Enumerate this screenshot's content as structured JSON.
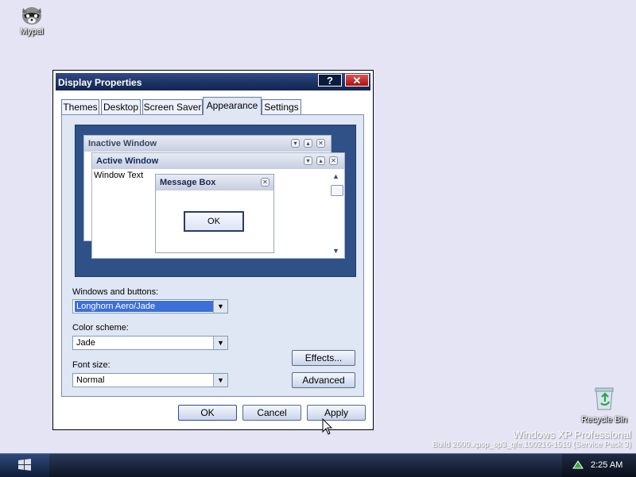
{
  "desktop": {
    "icon1_label": "Mypal",
    "recycle_label": "Recycle Bin",
    "watermark_line1": "Windows XP Professional",
    "watermark_line2": "Build 2600.xpsp_sp3_qfe.100216-1510 (Service Pack 3)"
  },
  "dialog": {
    "title": "Display Properties",
    "help_label": "?",
    "close_label": "✕",
    "tabs": [
      "Themes",
      "Desktop",
      "Screen Saver",
      "Appearance",
      "Settings"
    ],
    "active_tab": "Appearance",
    "preview": {
      "inactive_title": "Inactive Window",
      "active_title": "Active Window",
      "window_text": "Window Text",
      "msgbox_title": "Message Box",
      "msgbox_ok": "OK"
    },
    "windows_buttons_label": "Windows and buttons:",
    "windows_buttons_value": "Longhorn Aero/Jade",
    "color_scheme_label": "Color scheme:",
    "color_scheme_value": "Jade",
    "font_size_label": "Font size:",
    "font_size_value": "Normal",
    "effects_button": "Effects...",
    "advanced_button": "Advanced",
    "ok_button": "OK",
    "cancel_button": "Cancel",
    "apply_button": "Apply"
  },
  "taskbar": {
    "clock": "2:25 AM"
  },
  "colors": {
    "desktop_bg": "#e4e4f4",
    "titlebar": "#1e3364",
    "preview_bg": "#2f5188",
    "selection": "#3d6fd9"
  },
  "icons": [
    "raccoon-icon",
    "recycle-bin-icon",
    "start-windows-icon",
    "tray-network-icon",
    "cursor-icon"
  ]
}
